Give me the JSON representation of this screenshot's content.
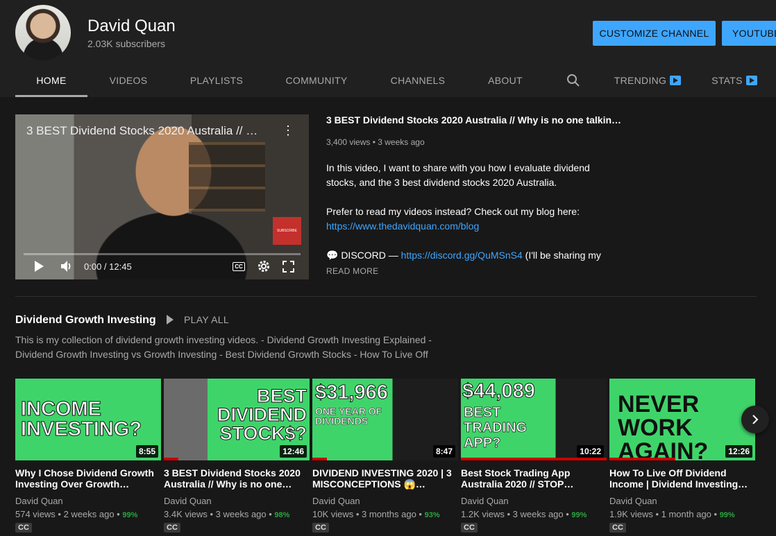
{
  "header": {
    "channel_name": "David Quan",
    "subscribers": "2.03K subscribers",
    "customize_label": "CUSTOMIZE CHANNEL",
    "studio_label": "YOUTUBE"
  },
  "tabs": [
    {
      "label": "HOME",
      "active": true
    },
    {
      "label": "VIDEOS"
    },
    {
      "label": "PLAYLISTS"
    },
    {
      "label": "COMMUNITY"
    },
    {
      "label": "CHANNELS"
    },
    {
      "label": "ABOUT"
    },
    {
      "label": "TRENDING"
    },
    {
      "label": "STATS"
    }
  ],
  "featured": {
    "player_title": "3 BEST Dividend Stocks 2020 Australia // …",
    "time": "0:00 / 12:45",
    "cc": "CC",
    "subscribe_badge": "SUBSCRIBE",
    "title": "3 BEST Dividend Stocks 2020 Australia // Why is no one talkin…",
    "meta": "3,400 views • 3 weeks ago",
    "desc_1": "In this video, I want to share with you how I evaluate dividend stocks, and the 3 best dividend stocks 2020 Australia.",
    "desc_2": "Prefer to read my videos instead? Check out my blog here:",
    "blog_link": "https://www.thedavidquan.com/blog",
    "discord_prefix": "💬 DISCORD — ",
    "discord_link": "https://discord.gg/QuMSnS4",
    "discord_suffix": " (I'll be sharing my",
    "read_more": "READ MORE"
  },
  "shelf": {
    "title": "Dividend Growth Investing",
    "play_all": "PLAY ALL",
    "description": "This is my collection of dividend growth investing videos. - Dividend Growth Investing Explained - Dividend Growth Investing vs Growth Investing - Best Dividend Growth Stocks - How To Live Off"
  },
  "videos": [
    {
      "thumb_text": "INCOME INVESTING?",
      "duration": "8:55",
      "title": "Why I Chose Dividend Growth Investing Over Growth…",
      "channel": "David Quan",
      "views": "574 views • 2 weeks ago • ",
      "pct": "99%",
      "cc": "CC",
      "watched": 0.0
    },
    {
      "thumb_text": "BEST DIVIDEND STOCK$?",
      "duration": "12:46",
      "title": "3 BEST Dividend Stocks 2020 Australia // Why is no one…",
      "channel": "David Quan",
      "views": "3.4K views • 3 weeks ago • ",
      "pct": "98%",
      "cc": "CC",
      "watched": 0.1
    },
    {
      "thumb_text_1": "$31,966",
      "thumb_text_2": "ONE YEAR OF DIVIDENDS",
      "duration": "8:47",
      "title": "DIVIDEND INVESTING 2020 | 3 MISCONCEPTIONS 😱…",
      "channel": "David Quan",
      "views": "10K views • 3 months ago • ",
      "pct": "93%",
      "cc": "CC",
      "watched": 0.1
    },
    {
      "thumb_text_1": "$44,089",
      "thumb_text_2": "BEST TRADING APP?",
      "duration": "10:22",
      "title": "Best Stock Trading App Australia 2020 // STOP…",
      "channel": "David Quan",
      "views": "1.2K views • 3 weeks ago • ",
      "pct": "99%",
      "cc": "CC",
      "watched": 1.0
    },
    {
      "thumb_text": "NEVER WORK AGAIN?",
      "duration": "12:26",
      "title": "How To Live Off Dividend Income | Dividend Investing…",
      "channel": "David Quan",
      "views": "1.9K views • 1 month ago • ",
      "pct": "99%",
      "cc": "CC",
      "watched": 0.45
    }
  ]
}
